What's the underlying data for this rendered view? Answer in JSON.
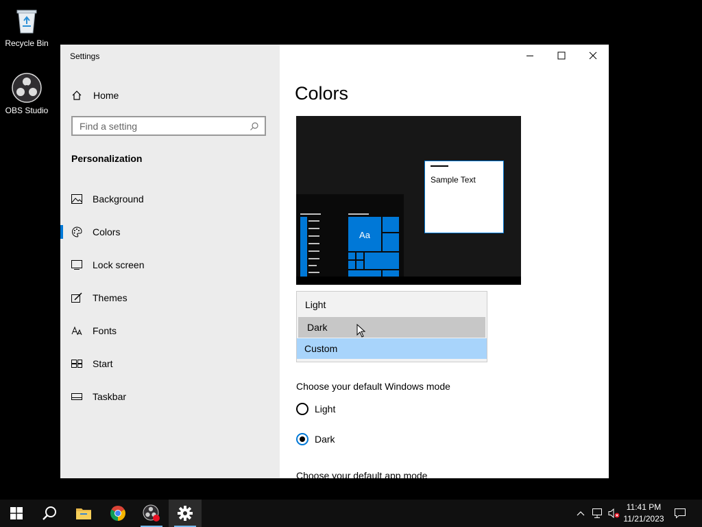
{
  "desktop": {
    "icons": [
      {
        "label": "Recycle Bin"
      },
      {
        "label": "OBS Studio"
      }
    ]
  },
  "window": {
    "title": "Settings",
    "sidebar": {
      "home_label": "Home",
      "search_placeholder": "Find a setting",
      "section_title": "Personalization",
      "items": [
        {
          "label": "Background",
          "icon": "image-icon"
        },
        {
          "label": "Colors",
          "icon": "palette-icon",
          "active": true
        },
        {
          "label": "Lock screen",
          "icon": "lock-screen-icon"
        },
        {
          "label": "Themes",
          "icon": "themes-brush-icon"
        },
        {
          "label": "Fonts",
          "icon": "fonts-icon"
        },
        {
          "label": "Start",
          "icon": "start-tiles-icon"
        },
        {
          "label": "Taskbar",
          "icon": "taskbar-icon"
        }
      ]
    },
    "content": {
      "title": "Colors",
      "preview": {
        "sample_text": "Sample Text",
        "tile_text": "Aa",
        "accent_color": "#0078d7"
      },
      "color_dropdown": {
        "options": [
          "Light",
          "Dark",
          "Custom"
        ],
        "hovered": "Dark",
        "selected": "Custom"
      },
      "windows_mode": {
        "label": "Choose your default Windows mode",
        "options": [
          "Light",
          "Dark"
        ],
        "selected": "Dark"
      },
      "app_mode_label": "Choose your default app mode"
    }
  },
  "taskbar": {
    "apps": [
      "start-icon",
      "search-icon",
      "file-explorer-icon",
      "chrome-icon",
      "obs-studio-icon",
      "settings-gear-icon"
    ],
    "active_app": "settings-gear-icon",
    "clock": {
      "time": "11:41 PM",
      "date": "11/21/2023"
    }
  }
}
